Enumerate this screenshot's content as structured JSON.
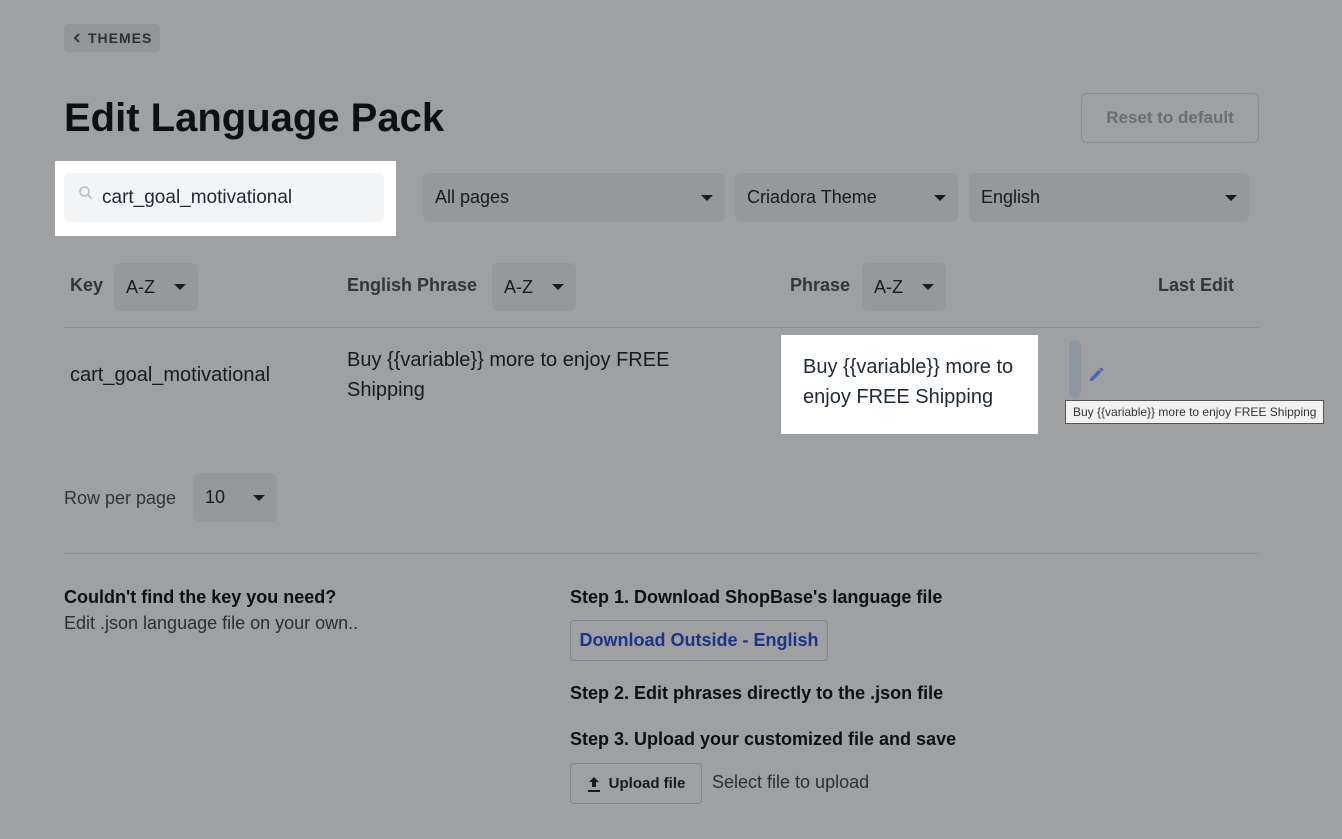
{
  "nav": {
    "back_label": "THEMES"
  },
  "page": {
    "title": "Edit Language Pack",
    "reset_label": "Reset to default"
  },
  "filters": {
    "search_value": "cart_goal_motivational",
    "pages": "All pages",
    "theme": "Criadora Theme",
    "language": "English"
  },
  "table": {
    "headers": {
      "key": "Key",
      "english_phrase": "English Phrase",
      "phrase": "Phrase",
      "last_edit": "Last Edit"
    },
    "sort_value": "A-Z",
    "rows": [
      {
        "key": "cart_goal_motivational",
        "english_phrase": "Buy {{variable}} more to enjoy FREE Shipping",
        "phrase": "Buy {{variable}} more to enjoy FREE Shipping",
        "tooltip": "Buy {{variable}} more to enjoy FREE Shipping"
      }
    ]
  },
  "pagination": {
    "label": "Row per page",
    "value": "10"
  },
  "help": {
    "title": "Couldn't find the key you need?",
    "subtitle": "Edit .json language file on your own..",
    "step1": "Step 1. Download ShopBase's language file",
    "download_label": "Download Outside - English",
    "step2": "Step 2. Edit phrases directly to the .json file",
    "step3": "Step 3. Upload your customized file and save",
    "upload_label": "Upload file",
    "upload_hint": "Select file to upload"
  },
  "colors": {
    "accent": "#2d4fd6",
    "overlay": "rgba(0,0,0,0.35)"
  }
}
